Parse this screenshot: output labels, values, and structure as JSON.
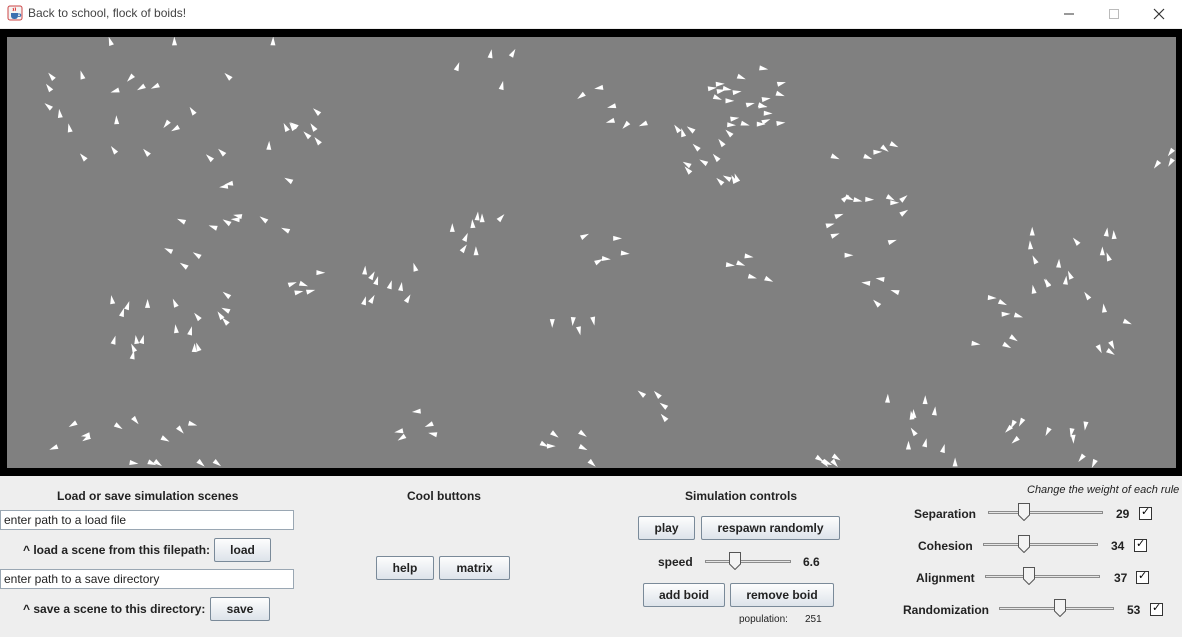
{
  "window": {
    "title": "Back to school, flock of boids!",
    "icons": [
      "java-coffee-icon",
      "minimize-icon",
      "maximize-icon",
      "close-icon"
    ]
  },
  "canvas": {
    "background_color": "#808080",
    "border_color": "#000000",
    "boid_color": "#ffffff",
    "boid_count_shown": 251
  },
  "scenes": {
    "title": "Load or save simulation scenes",
    "load_input_value": "enter path to a load file",
    "load_label": "^ load a scene from this filepath:",
    "load_button": "load",
    "save_input_value": "enter path to a save directory",
    "save_label": "^ save a scene to this directory:",
    "save_button": "save"
  },
  "cool": {
    "title": "Cool buttons",
    "help_button": "help",
    "matrix_button": "matrix"
  },
  "controls": {
    "title": "Simulation controls",
    "play_button": "play",
    "respawn_button": "respawn randomly",
    "speed_label": "speed",
    "speed_value": "6.6",
    "speed_fraction": 0.33,
    "add_button": "add boid",
    "remove_button": "remove boid",
    "population_label": "population:",
    "population_value": "251"
  },
  "rules": {
    "hint": "Change the weight of each rule",
    "items": [
      {
        "label": "Separation",
        "value": "29",
        "fraction": 0.29,
        "checked": true
      },
      {
        "label": "Cohesion",
        "value": "34",
        "fraction": 0.34,
        "checked": true
      },
      {
        "label": "Alignment",
        "value": "37",
        "fraction": 0.37,
        "checked": true
      },
      {
        "label": "Randomization",
        "value": "53",
        "fraction": 0.53,
        "checked": true
      }
    ]
  }
}
